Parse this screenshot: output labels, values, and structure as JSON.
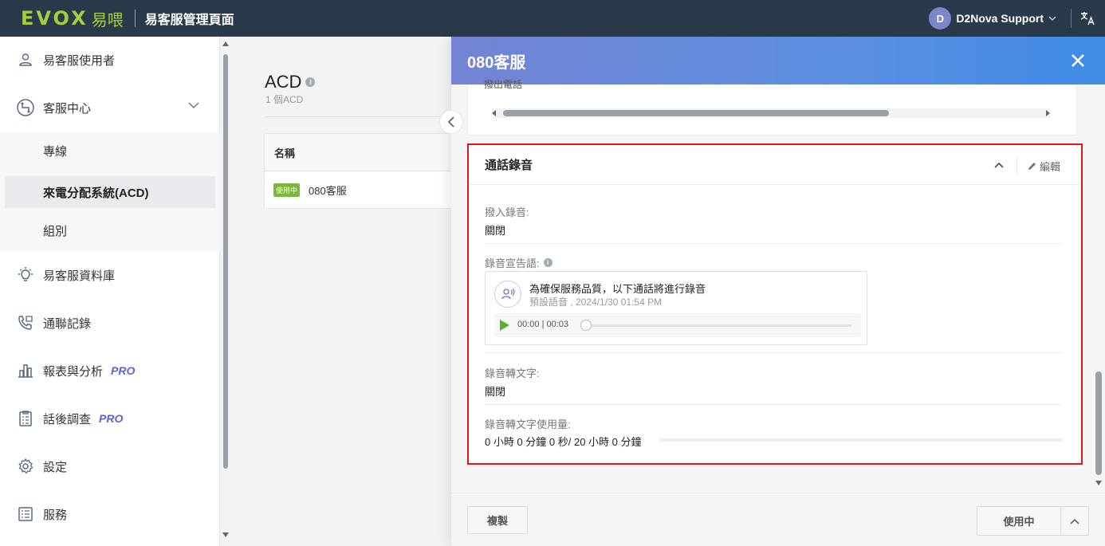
{
  "topbar": {
    "logo_text": "EVOX",
    "logo_cn": "易喂",
    "title": "易客服管理頁面",
    "user_initial": "D",
    "user_name": "D2Nova Support",
    "lang_icon": "translate-icon"
  },
  "sidebar": {
    "items": [
      {
        "label": "易客服使用者",
        "icon": "user-icon"
      },
      {
        "label": "客服中心",
        "icon": "call-center-icon"
      },
      {
        "label": "易客服資料庫",
        "icon": "lightbulb-icon"
      },
      {
        "label": "通聯記錄",
        "icon": "phone-log-icon"
      },
      {
        "label": "報表與分析",
        "pro": "PRO",
        "icon": "bar-chart-icon"
      },
      {
        "label": "話後調查",
        "pro": "PRO",
        "icon": "survey-icon"
      },
      {
        "label": "設定",
        "icon": "gear-icon"
      },
      {
        "label": "服務",
        "icon": "service-icon"
      }
    ],
    "sub_items": [
      {
        "label": "專線"
      },
      {
        "label": "來電分配系統(ACD)"
      },
      {
        "label": "組別"
      }
    ]
  },
  "main": {
    "title": "ACD",
    "count": "1 個ACD",
    "table": {
      "header": "名稱",
      "rows": [
        {
          "badge": "使用中",
          "name": "080客服"
        }
      ]
    }
  },
  "drawer": {
    "title": "080客服",
    "prev_section_text": "撥出電話",
    "recording": {
      "title": "通話錄音",
      "edit_label": "編輯",
      "inbound_label": "撥入錄音:",
      "inbound_value": "關閉",
      "announce_label": "錄音宣告語:",
      "audio": {
        "title": "為確保服務品質，以下通話將進行錄音",
        "meta": "預設語音 , 2024/1/30 01:54 PM",
        "time": "00:00 | 00:03",
        "progress": 0
      },
      "transcribe_label": "錄音轉文字:",
      "transcribe_value": "關閉",
      "usage_label": "錄音轉文字使用量:",
      "usage_value": "0 小時 0 分鐘 0 秒/ 20 小時 0 分鐘",
      "usage_fraction": 0
    },
    "footer": {
      "copy_label": "複製",
      "status_label": "使用中"
    }
  },
  "colors": {
    "topbar": "#2b3a4a",
    "logo": "#a4cf3a",
    "accent": "#5b8fe0",
    "highlight_border": "#e0181e",
    "active_badge": "#7ab83b",
    "pro": "#5b63d9"
  }
}
